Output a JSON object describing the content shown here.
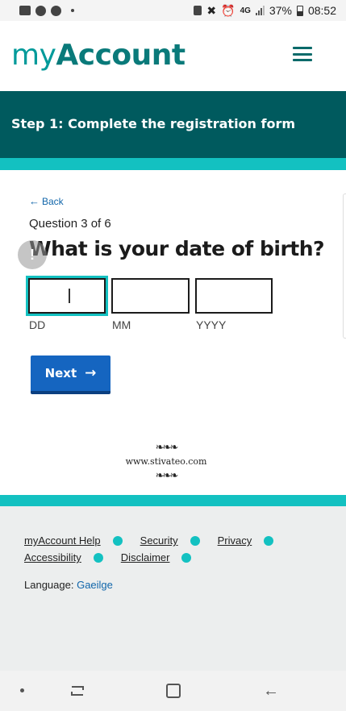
{
  "status_bar": {
    "network": "4G",
    "battery": "37%",
    "time": "08:52"
  },
  "header": {
    "logo_light": "my",
    "logo_bold": "Account",
    "menu_icon": "hamburger-icon"
  },
  "banner": {
    "step_title": "Step 1: Complete the registration form"
  },
  "form": {
    "back_label": "Back",
    "counter": "Question 3 of 6",
    "question": "What is your date of birth?",
    "fields": {
      "day": {
        "value": "",
        "label": "DD"
      },
      "month": {
        "value": "",
        "label": "MM"
      },
      "year": {
        "value": "",
        "label": "YYYY"
      }
    },
    "next_label": "Next"
  },
  "watermark": {
    "text": "www.stivateo.com"
  },
  "footer": {
    "links": [
      "myAccount Help",
      "Security",
      "Privacy",
      "Accessibility",
      "Disclaimer"
    ],
    "language_label": "Language:",
    "language_value": "Gaeilge"
  },
  "colors": {
    "brand_teal": "#009a9a",
    "banner": "#005a5e",
    "accent": "#13c1c1",
    "button": "#1565c0"
  }
}
